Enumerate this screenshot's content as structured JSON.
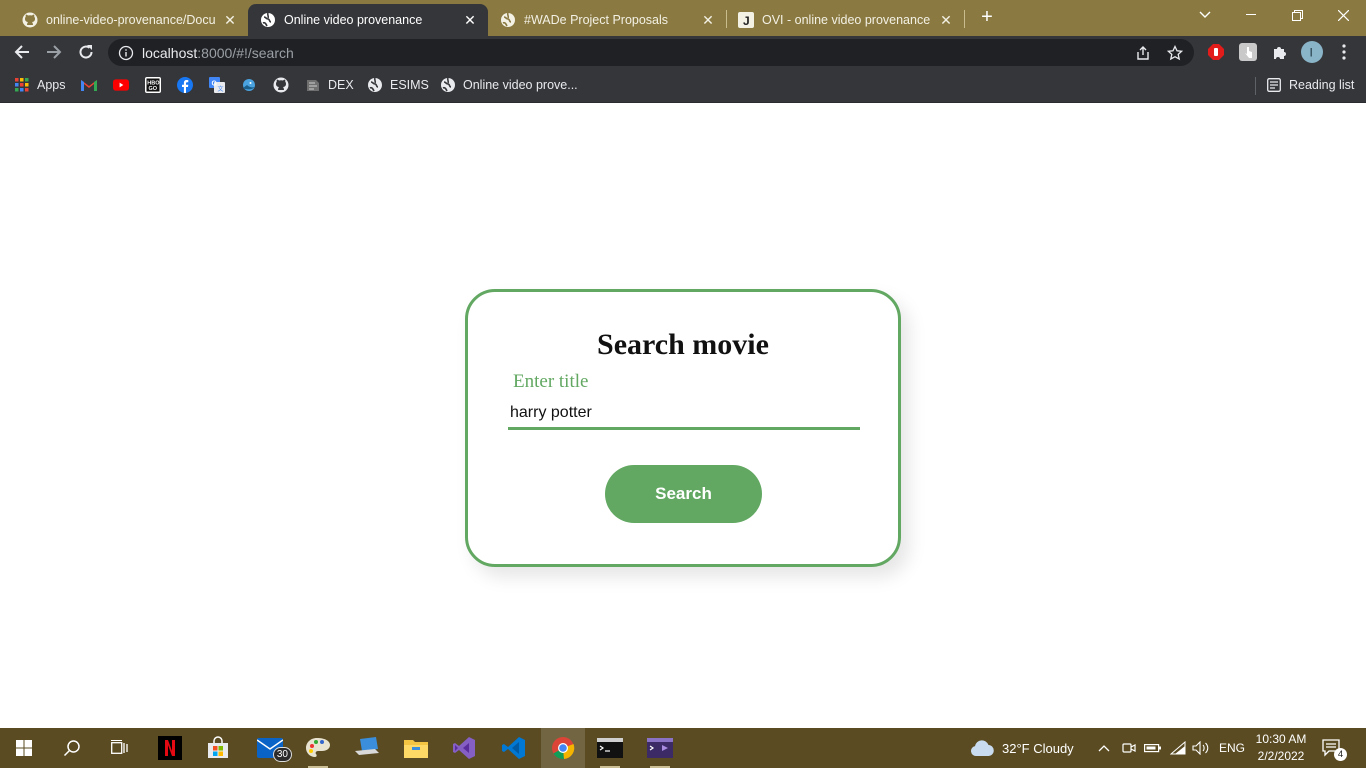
{
  "browser": {
    "tabs": [
      {
        "title": "online-video-provenance/Docum",
        "icon": "github-icon",
        "active": false
      },
      {
        "title": "Online video provenance",
        "icon": "globe-icon",
        "active": true
      },
      {
        "title": "#WADe Project Proposals",
        "icon": "globe-icon",
        "active": false
      },
      {
        "title": "OVI - online video provenance - ·",
        "icon": "j-app-icon",
        "active": false
      }
    ],
    "url": {
      "host": "localhost",
      "path": ":8000/#!/search"
    },
    "bookmarks": [
      {
        "label": "Apps",
        "icon": "apps-grid-icon"
      },
      {
        "label": "",
        "icon": "gmail-icon"
      },
      {
        "label": "",
        "icon": "youtube-icon"
      },
      {
        "label": "",
        "icon": "hbo-go-icon"
      },
      {
        "label": "",
        "icon": "facebook-icon"
      },
      {
        "label": "",
        "icon": "translate-icon"
      },
      {
        "label": "",
        "icon": "bird-icon"
      },
      {
        "label": "",
        "icon": "github-icon"
      },
      {
        "label": "DEX",
        "icon": "dex-icon"
      },
      {
        "label": "ESIMS",
        "icon": "globe-icon"
      },
      {
        "label": "Online video prove...",
        "icon": "globe-icon"
      }
    ],
    "reading_list": "Reading list",
    "profile_initial": "I"
  },
  "page": {
    "heading": "Search movie",
    "input_label": "Enter title",
    "input_value": "harry potter",
    "search_button": "Search"
  },
  "taskbar": {
    "mail_badge": "30",
    "weather": "32°F  Cloudy",
    "language": "ENG",
    "time": "10:30 AM",
    "date": "2/2/2022",
    "notifications": "4"
  },
  "colors": {
    "accent_green": "#62a862",
    "tab_strip": "#8a7a42",
    "toolbar": "#35363a",
    "taskbar": "#5a4b22"
  }
}
